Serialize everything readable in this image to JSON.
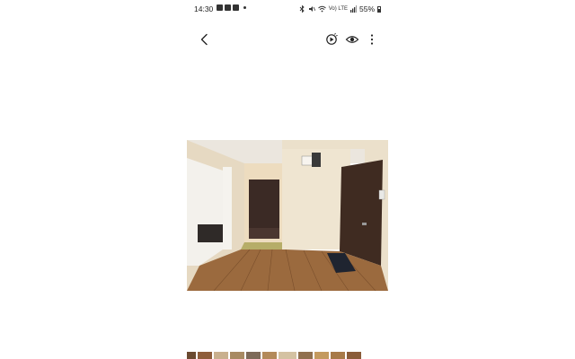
{
  "status_bar": {
    "time": "14:30",
    "battery": "55%",
    "network_label": "Vo) LTE",
    "left_icons": [
      "gallery-icon",
      "mail-icon",
      "check-icon"
    ],
    "right_icons": [
      "bluetooth-icon",
      "mute-icon",
      "wifi-icon",
      "signal-icon",
      "battery-icon"
    ]
  },
  "toolbar": {
    "icons": [
      "back-icon",
      "remaster-icon",
      "visibility-icon",
      "more-icon"
    ]
  },
  "photo": {
    "subject": "apartment hallway with wooden floor",
    "colors": {
      "ceiling": "#ece7df",
      "wall_left": "#e8dcc8",
      "wall_right": "#efe5d2",
      "floor": "#9a6a3c",
      "door": "#3e2a20",
      "tiles": "#b8b06a"
    }
  },
  "thumbnails": {
    "count": 11,
    "colors": [
      "#6b4a30",
      "#8e5d3a",
      "#c9b08e",
      "#a88a62",
      "#7d6a58",
      "#b38a5a",
      "#d4c2a2",
      "#90704e",
      "#c49a5e",
      "#a87a48",
      "#8a5c38"
    ]
  }
}
